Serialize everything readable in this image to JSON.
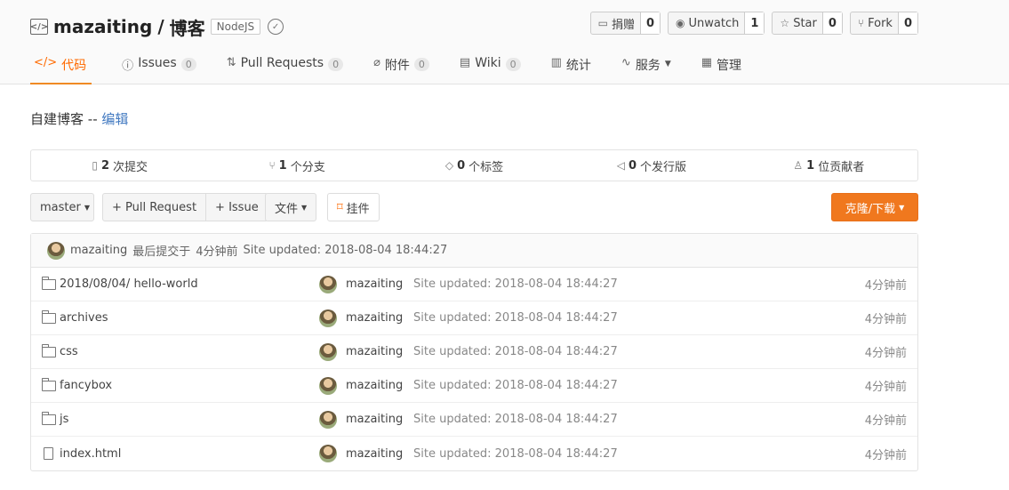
{
  "repo": {
    "owner": "mazaiting",
    "separator": "/",
    "name": "博客",
    "language": "NodeJS"
  },
  "actions": [
    {
      "label": "捐赠",
      "count": "0",
      "icon": "donate-icon"
    },
    {
      "label": "Unwatch",
      "count": "1",
      "icon": "eye-icon"
    },
    {
      "label": "Star",
      "count": "0",
      "icon": "star-icon"
    },
    {
      "label": "Fork",
      "count": "0",
      "icon": "fork-icon"
    }
  ],
  "tabs": [
    {
      "label": "代码",
      "icon": "code-icon",
      "count": null,
      "active": true
    },
    {
      "label": "Issues",
      "icon": "issue-icon",
      "count": "0"
    },
    {
      "label": "Pull Requests",
      "icon": "pull-request-icon",
      "count": "0"
    },
    {
      "label": "附件",
      "icon": "attachment-icon",
      "count": "0"
    },
    {
      "label": "Wiki",
      "icon": "wiki-icon",
      "count": "0"
    },
    {
      "label": "统计",
      "icon": "stats-icon",
      "count": null
    },
    {
      "label": "服务",
      "icon": "service-icon",
      "count": null,
      "dropdown": true
    },
    {
      "label": "管理",
      "icon": "manage-icon",
      "count": null
    }
  ],
  "description": {
    "text": "自建博客",
    "separator": "--",
    "edit_label": "编辑"
  },
  "stats": [
    {
      "count": "2",
      "label": "次提交",
      "icon": "commit-icon"
    },
    {
      "count": "1",
      "label": "个分支",
      "icon": "branch-icon"
    },
    {
      "count": "0",
      "label": "个标签",
      "icon": "tag-icon"
    },
    {
      "count": "0",
      "label": "个发行版",
      "icon": "release-icon"
    },
    {
      "count": "1",
      "label": "位贡献者",
      "icon": "contributor-icon"
    }
  ],
  "toolbar": {
    "branch": "master",
    "pull_request": "+ Pull Request",
    "issue": "+ Issue",
    "file": "文件",
    "widget": "挂件",
    "clone": "克隆/下载"
  },
  "last_commit": {
    "author": "mazaiting",
    "label": "最后提交于",
    "time": "4分钟前",
    "message": "Site updated: 2018-08-04 18:44:27"
  },
  "files": [
    {
      "name": "2018/08/04/ hello-world",
      "type": "folder",
      "author": "mazaiting",
      "message": "Site updated: 2018-08-04 18:44:27",
      "time": "4分钟前"
    },
    {
      "name": "archives",
      "type": "folder",
      "author": "mazaiting",
      "message": "Site updated: 2018-08-04 18:44:27",
      "time": "4分钟前"
    },
    {
      "name": "css",
      "type": "folder",
      "author": "mazaiting",
      "message": "Site updated: 2018-08-04 18:44:27",
      "time": "4分钟前"
    },
    {
      "name": "fancybox",
      "type": "folder",
      "author": "mazaiting",
      "message": "Site updated: 2018-08-04 18:44:27",
      "time": "4分钟前"
    },
    {
      "name": "js",
      "type": "folder",
      "author": "mazaiting",
      "message": "Site updated: 2018-08-04 18:44:27",
      "time": "4分钟前"
    },
    {
      "name": "index.html",
      "type": "file",
      "author": "mazaiting",
      "message": "Site updated: 2018-08-04 18:44:27",
      "time": "4分钟前"
    }
  ],
  "colors": {
    "accent": "#ff6a00",
    "clone_button": "#f0781e"
  }
}
